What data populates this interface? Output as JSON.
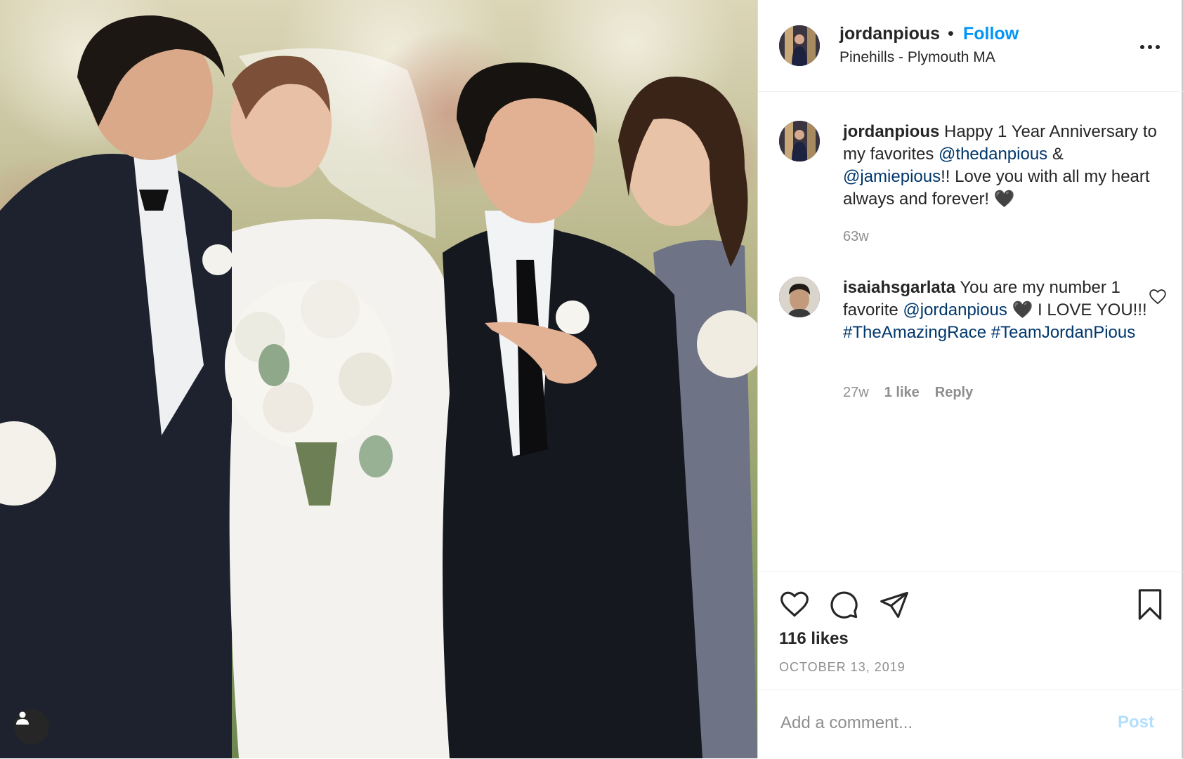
{
  "post": {
    "username": "jordanpious",
    "separator": "•",
    "follow_label": "Follow",
    "location": "Pinehills - Plymouth MA",
    "caption": {
      "username": "jordanpious",
      "text_1": " Happy 1 Year Anniversary to my favorites ",
      "mention_1": "@thedanpious",
      "text_2": " & ",
      "mention_2": "@jamiepious",
      "text_3": "!! Love you with all my heart always and forever! 🖤",
      "age": "63w"
    },
    "comments": [
      {
        "username": "isaiahsgarlata",
        "text_1": " You are my number 1 favorite ",
        "mention_1": "@jordanpious",
        "text_2": " 🖤 I LOVE YOU!!! ",
        "hashtag_1": "#TheAmazingRace",
        "hashtag_2": "#TeamJordanPious",
        "age": "27w",
        "likes": "1 like",
        "reply_label": "Reply"
      }
    ],
    "likes": "116 likes",
    "date": "OCTOBER 13, 2019",
    "comment_placeholder": "Add a comment...",
    "post_label": "Post"
  },
  "icons": {
    "like": "heart-icon",
    "comment": "comment-bubble-icon",
    "share": "paper-plane-icon",
    "save": "bookmark-icon",
    "tagged": "user-tag-icon",
    "more": "more-horizontal-icon"
  },
  "colors": {
    "link_blue": "#0095f6",
    "mention_blue": "#00376b",
    "secondary_text": "#8e8e8e",
    "post_disabled": "#b2dffc"
  }
}
